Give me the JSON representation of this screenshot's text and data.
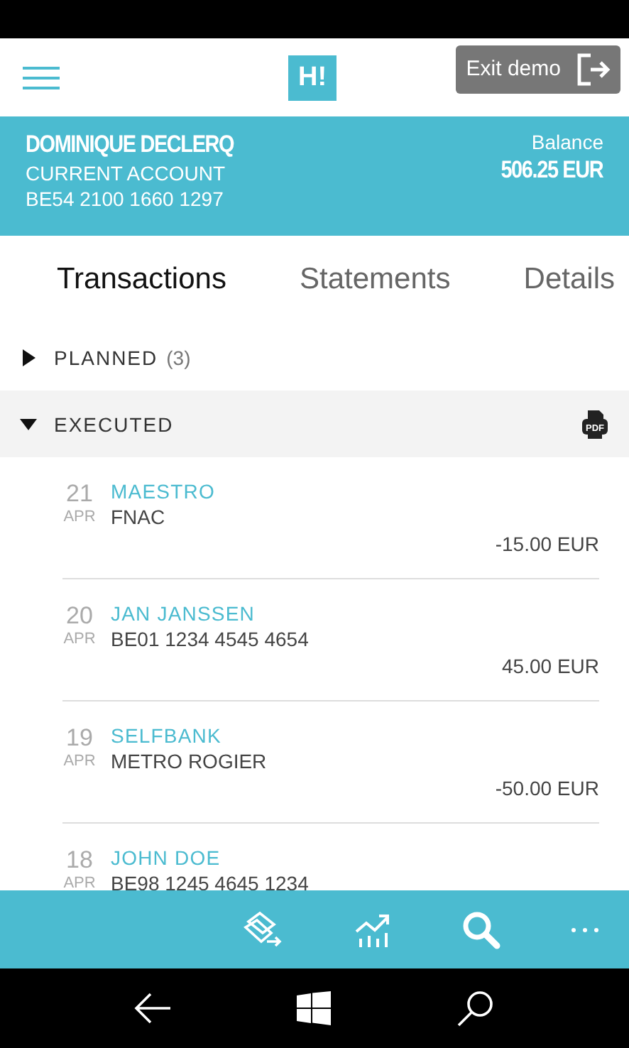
{
  "header": {
    "logo": "H!",
    "exit_button": "Exit demo"
  },
  "account": {
    "holder": "DOMINIQUE DECLERQ",
    "type": "CURRENT ACCOUNT",
    "iban": "BE54 2100 1660 1297",
    "balance_label": "Balance",
    "balance": "506.25  EUR"
  },
  "tabs": [
    {
      "label": "Transactions",
      "selected": true
    },
    {
      "label": "Statements",
      "selected": false
    },
    {
      "label": "Details",
      "selected": false
    }
  ],
  "sections": [
    {
      "label": "PLANNED",
      "count": "(3)",
      "expanded": false
    },
    {
      "label": "EXECUTED",
      "expanded": true,
      "pdf": "PDF"
    }
  ],
  "transactions": [
    {
      "day": "21",
      "month": "APR",
      "name": "MAESTRO",
      "detail": "FNAC",
      "amount": "-15.00  EUR"
    },
    {
      "day": "20",
      "month": "APR",
      "name": "JAN JANSSEN",
      "detail": "BE01 1234 4545 4654",
      "amount": "45.00  EUR"
    },
    {
      "day": "19",
      "month": "APR",
      "name": "SELFBANK",
      "detail": "METRO ROGIER",
      "amount": "-50.00  EUR"
    },
    {
      "day": "18",
      "month": "APR",
      "name": "JOHN DOE",
      "detail": "BE98 1245 4645 1234"
    }
  ]
}
